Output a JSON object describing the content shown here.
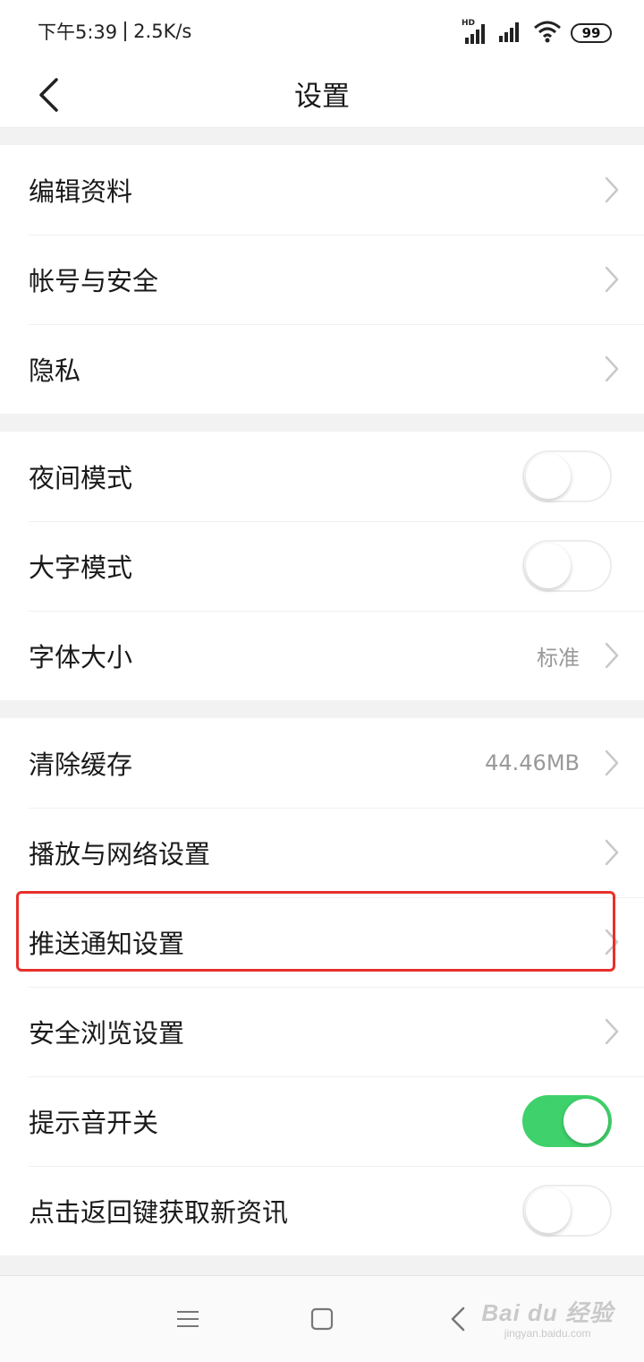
{
  "status_bar": {
    "time": "下午5:39",
    "network_speed": "2.5K/s",
    "hd_badge": "HD",
    "battery": "99"
  },
  "header": {
    "title": "设置"
  },
  "group1": {
    "edit_profile": "编辑资料",
    "account_security": "帐号与安全",
    "privacy": "隐私"
  },
  "group2": {
    "night_mode": "夜间模式",
    "night_mode_on": false,
    "large_text_mode": "大字模式",
    "large_text_mode_on": false,
    "font_size": "字体大小",
    "font_size_value": "标准"
  },
  "group3": {
    "clear_cache": "清除缓存",
    "clear_cache_value": "44.46MB",
    "playback_network": "播放与网络设置",
    "push_notification": "推送通知设置",
    "safe_browsing": "安全浏览设置",
    "notification_sound": "提示音开关",
    "notification_sound_on": true,
    "back_key_refresh": "点击返回键获取新资讯",
    "back_key_refresh_on": false
  },
  "icons": {
    "back": "chevron-left-icon",
    "row_arrow": "chevron-right-icon",
    "menu": "menu-icon",
    "home": "square-icon",
    "system_back": "triangle-back-icon"
  },
  "colors": {
    "toggle_on": "#3fd16b",
    "highlight": "#e8302a",
    "value_text": "#999999"
  },
  "watermark": {
    "main": "Bai du 经验",
    "sub": "jingyan.baidu.com"
  }
}
